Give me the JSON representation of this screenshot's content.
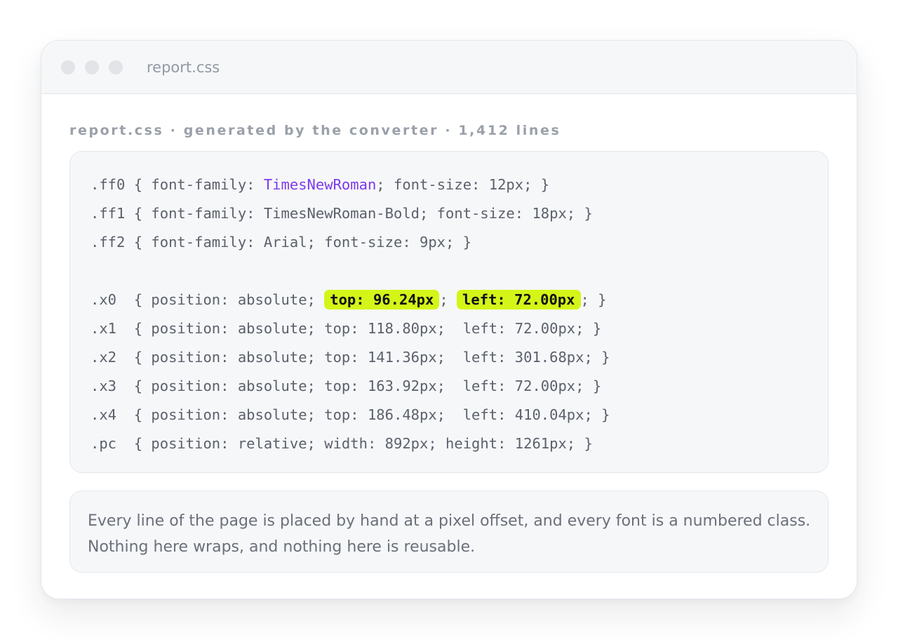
{
  "window": {
    "title": "report.css",
    "controls": [
      "close",
      "minimize",
      "maximize"
    ]
  },
  "caption": "report.css · generated by the converter · 1,412 lines",
  "code": {
    "lines": [
      {
        "segments": [
          {
            "text": ".ff0 { font-family: ",
            "style": "plain"
          },
          {
            "text": "TimesNewRoman",
            "style": "accent"
          },
          {
            "text": "; font-size: 12px; }",
            "style": "plain"
          }
        ]
      },
      {
        "segments": [
          {
            "text": ".ff1 { font-family: TimesNewRoman-Bold; font-size: 18px; }",
            "style": "plain"
          }
        ]
      },
      {
        "segments": [
          {
            "text": ".ff2 { font-family: Arial; font-size: 9px; }",
            "style": "plain"
          }
        ]
      },
      {
        "segments": []
      },
      {
        "segments": [
          {
            "text": ".x0  { position: absolute; ",
            "style": "plain"
          },
          {
            "text": "top: 96.24px",
            "style": "highlight"
          },
          {
            "text": "; ",
            "style": "plain"
          },
          {
            "text": "left: 72.00px",
            "style": "highlight"
          },
          {
            "text": "; }",
            "style": "plain"
          }
        ]
      },
      {
        "segments": [
          {
            "text": ".x1  { position: absolute; top: 118.80px;  left: 72.00px; }",
            "style": "plain"
          }
        ]
      },
      {
        "segments": [
          {
            "text": ".x2  { position: absolute; top: 141.36px;  left: 301.68px; }",
            "style": "plain"
          }
        ]
      },
      {
        "segments": [
          {
            "text": ".x3  { position: absolute; top: 163.92px;  left: 72.00px; }",
            "style": "plain"
          }
        ]
      },
      {
        "segments": [
          {
            "text": ".x4  { position: absolute; top: 186.48px;  left: 410.04px; }",
            "style": "plain"
          }
        ]
      },
      {
        "segments": [
          {
            "text": ".pc  { position: relative; width: 892px; height: 1261px; }",
            "style": "plain"
          }
        ]
      }
    ]
  },
  "note": "Every line of the page is placed by hand at a pixel offset, and every font is a numbered class. Nothing here wraps, and nothing here is reusable.",
  "colors": {
    "accent": "#7c3aed",
    "highlight": "#d4f518",
    "code_text": "#5b616b",
    "muted": "#9aa0a9"
  }
}
